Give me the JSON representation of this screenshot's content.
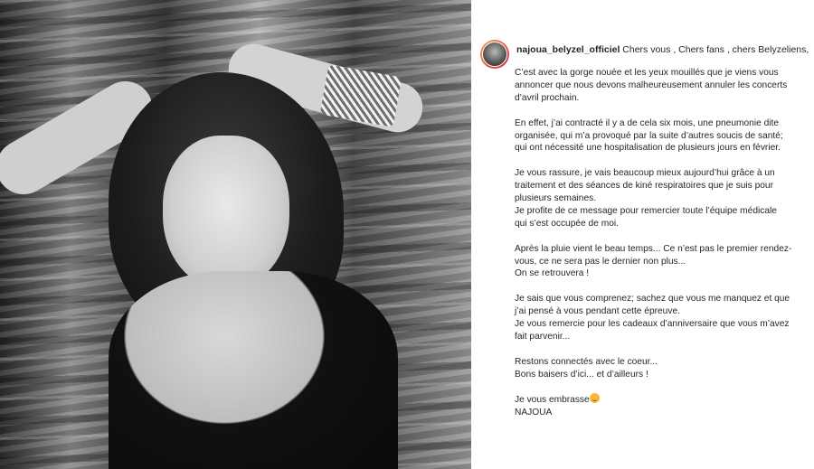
{
  "photo": {
    "description_icon": "portrait-photo"
  },
  "post": {
    "username": "najoua_belyzel_officiel",
    "first_line": " Chers vous , Chers fans , chers Belyzeliens,",
    "paragraphs": [
      [
        "C’est avec la gorge nouée et les yeux mouillés que je viens vous",
        "annoncer que nous devons malheureusement annuler les concerts",
        "d’avril prochain."
      ],
      [
        "En effet, j’ai contracté il y a de cela six mois, une pneumonie dite",
        "organisée, qui m’a provoqué par la suite d’autres soucis de santé;",
        "qui ont nécessité une hospitalisation de plusieurs jours en février."
      ],
      [
        "Je vous rassure, je vais beaucoup mieux aujourd’hui grâce à un",
        "traitement et des séances de kiné respiratoires que je suis pour",
        "plusieurs semaines.",
        "Je profite de ce message pour remercier toute l’équipe médicale",
        "qui s’est occupée de moi."
      ],
      [
        "Après la pluie vient le beau temps... Ce n’est pas le premier rendez-",
        "vous, ce ne sera pas le dernier non plus...",
        "On se retrouvera !"
      ],
      [
        "Je sais que vous comprenez; sachez que vous me manquez et que",
        "j’ai pensé à vous pendant cette épreuve.",
        "Je vous remercie pour les cadeaux d’anniversaire que vous m’avez",
        "fait parvenir..."
      ],
      [
        "Restons connectés avec le coeur...",
        "Bons baisers d’ici... et d’ailleurs !"
      ]
    ],
    "closing_line": "Je vous embrasse",
    "emoji_icon": "smiling-face-emoji-icon",
    "signature": "NAJOUA"
  },
  "colors": {
    "text": "#262626",
    "avatar_ring": "#d7263d"
  }
}
